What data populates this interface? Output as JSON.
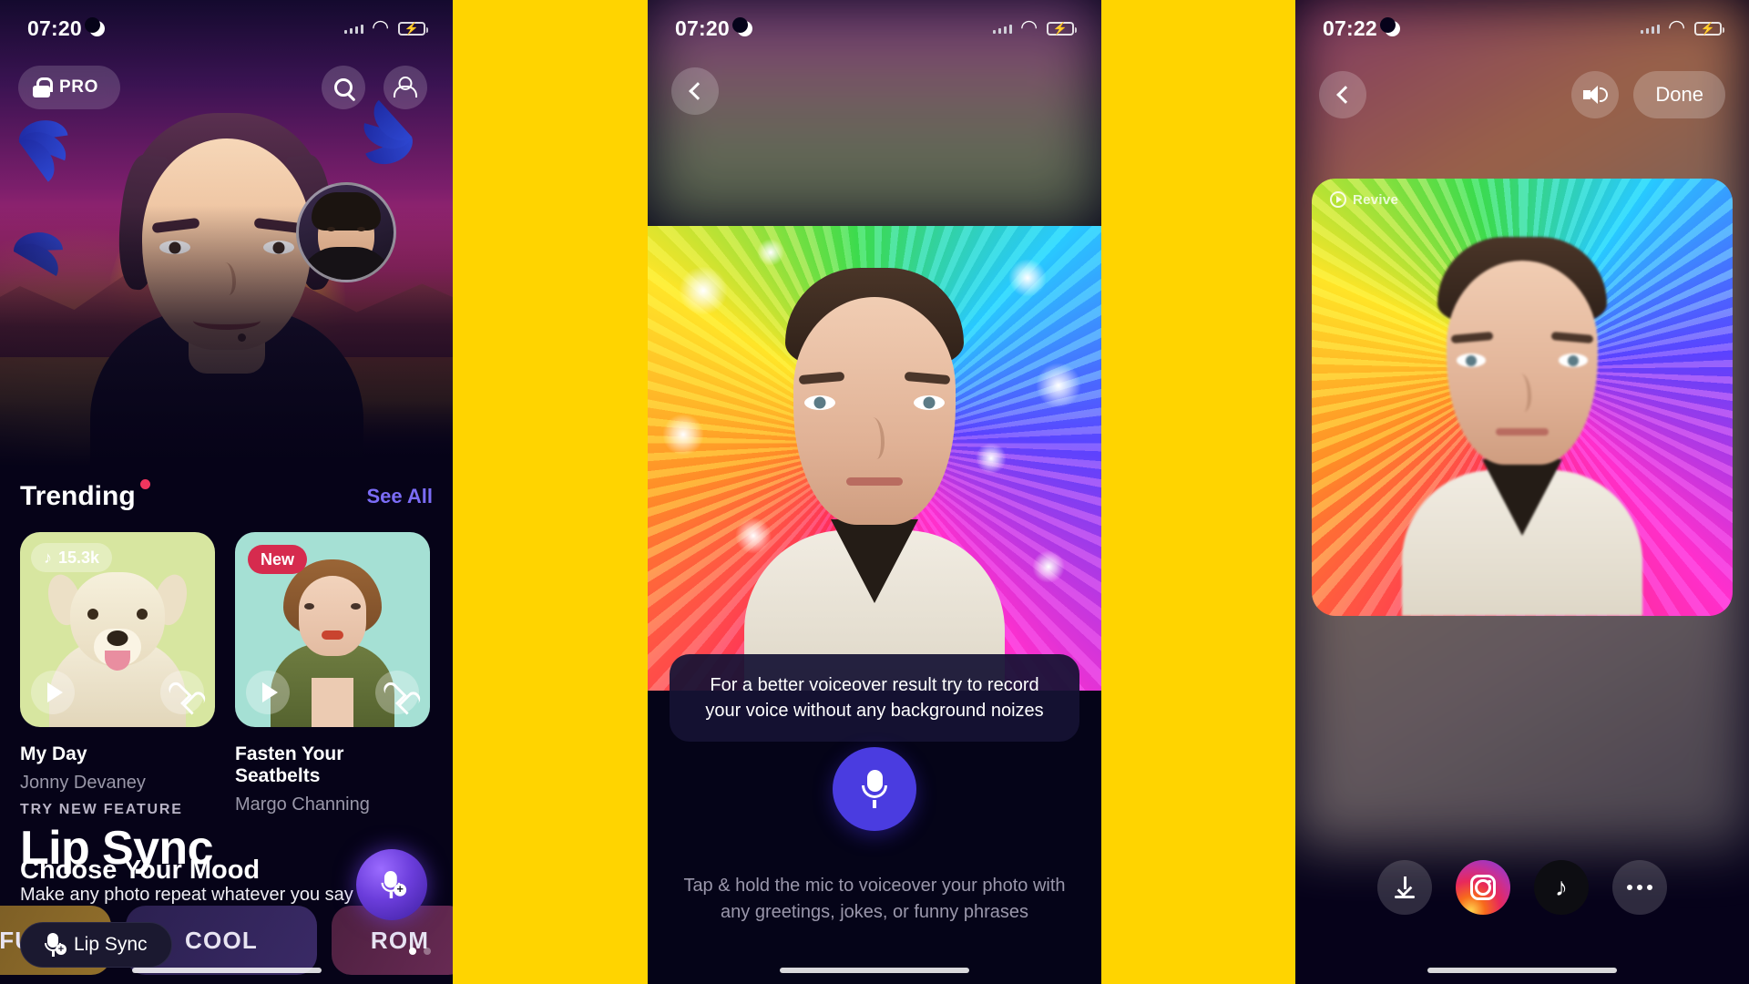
{
  "panels": {
    "home": {
      "status": {
        "time": "07:20",
        "moon_icon": "moon-icon",
        "battery_icon": "battery-charging-icon"
      },
      "pro_badge": {
        "label": "PRO",
        "icon": "lock-icon"
      },
      "search_icon": "search-icon",
      "profile_icon": "person-icon",
      "hero": {
        "kicker": "TRY NEW FEATURE",
        "title": "Lip Sync",
        "subtitle": "Make any photo repeat whatever you say",
        "cta_label": "Lip Sync",
        "cta_icon": "mic-add-icon",
        "carousel_dots": 2,
        "carousel_active": 0
      },
      "trending": {
        "title": "Trending",
        "see_all": "See All",
        "cards": [
          {
            "chip": "15.3k",
            "chip_type": "music",
            "chip_icon": "music-note-icon",
            "name": "My Day",
            "author": "Jonny Devaney",
            "play_icon": "play-icon",
            "like_icon": "heart-icon",
            "bg_color": "#d7e6a0"
          },
          {
            "chip": "New",
            "chip_type": "new",
            "name": "Fasten Your Seatbelts",
            "author": "Margo Channing",
            "play_icon": "play-icon",
            "like_icon": "heart-icon",
            "bg_color": "#a5e0d4"
          }
        ]
      },
      "mood": {
        "title": "Choose Your Mood",
        "tabs": [
          "FUNNY",
          "COOL",
          "ROM"
        ]
      },
      "fab_icon": "mic-fab-icon"
    },
    "record": {
      "status": {
        "time": "07:20",
        "moon_icon": "moon-icon",
        "battery_icon": "battery-charging-icon"
      },
      "back_icon": "chevron-left-icon",
      "tooltip": "For a better voiceover result try to record your voice without any background noizes",
      "mic_button_icon": "microphone-icon",
      "hint": "Tap & hold the mic to voiceover your photo with any greetings, jokes, or funny phrases"
    },
    "result": {
      "status": {
        "time": "07:22",
        "moon_icon": "moon-icon",
        "battery_icon": "battery-charging-icon"
      },
      "back_icon": "chevron-left-icon",
      "speaker_icon": "speaker-icon",
      "done_label": "Done",
      "watermark": "Revive",
      "share": [
        {
          "name": "download-button",
          "icon": "download-icon",
          "label": ""
        },
        {
          "name": "instagram-button",
          "icon": "instagram-icon",
          "label": ""
        },
        {
          "name": "tiktok-button",
          "icon": "tiktok-icon",
          "label": "♪"
        },
        {
          "name": "more-button",
          "icon": "more-dots-icon",
          "label": ""
        }
      ]
    }
  },
  "colors": {
    "background": "#FFD400",
    "panel_dark": "#060318",
    "accent_purple": "#7b6cf6",
    "mic_blue": "#4a3ce0",
    "badge_red": "#f0365e",
    "new_chip": "#d62b4e"
  }
}
